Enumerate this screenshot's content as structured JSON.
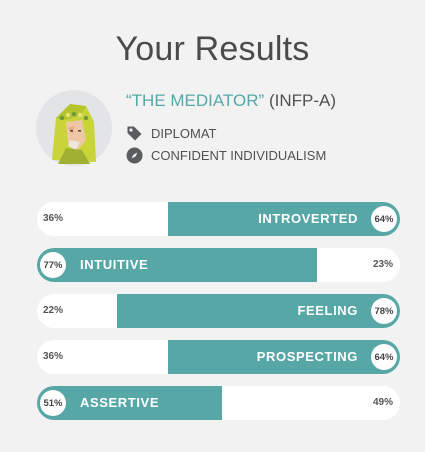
{
  "page": {
    "title": "Your Results"
  },
  "profile": {
    "type_name": "“THE MEDIATOR”",
    "type_code": "(INFP-A)",
    "role": "DIPLOMAT",
    "strategy": "CONFIDENT INDIVIDUALISM",
    "role_icon": "tag-icon",
    "strategy_icon": "compass-icon"
  },
  "colors": {
    "accent": "#57a7a7",
    "bar_bg": "#ffffff",
    "page_bg": "#f2f2f2"
  },
  "traits": [
    {
      "label": "INTROVERTED",
      "pct": "64%",
      "other_pct": "36%",
      "fraction": 0.64,
      "side": "right"
    },
    {
      "label": "INTUITIVE",
      "pct": "77%",
      "other_pct": "23%",
      "fraction": 0.77,
      "side": "left"
    },
    {
      "label": "FEELING",
      "pct": "78%",
      "other_pct": "22%",
      "fraction": 0.78,
      "side": "right"
    },
    {
      "label": "PROSPECTING",
      "pct": "64%",
      "other_pct": "36%",
      "fraction": 0.64,
      "side": "right"
    },
    {
      "label": "ASSERTIVE",
      "pct": "51%",
      "other_pct": "49%",
      "fraction": 0.51,
      "side": "left"
    }
  ]
}
